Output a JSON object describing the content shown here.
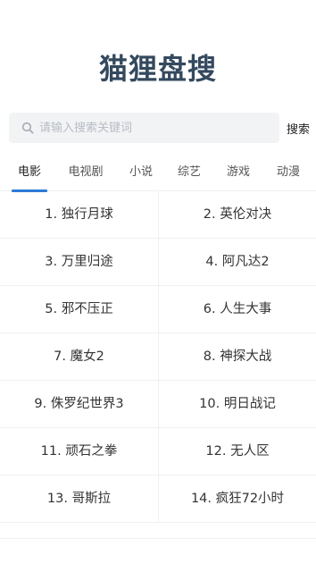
{
  "app": {
    "title": "猫狸盘搜"
  },
  "search": {
    "placeholder": "请输入搜索关键词",
    "value": "",
    "button_label": "搜索"
  },
  "tabs": [
    {
      "label": "电影",
      "active": true
    },
    {
      "label": "电视剧",
      "active": false
    },
    {
      "label": "小说",
      "active": false
    },
    {
      "label": "综艺",
      "active": false
    },
    {
      "label": "游戏",
      "active": false
    },
    {
      "label": "动漫",
      "active": false
    }
  ],
  "results": [
    "1. 独行月球",
    "2. 英伦对决",
    "3. 万里归途",
    "4. 阿凡达2",
    "5. 邪不压正",
    "6. 人生大事",
    "7. 魔女2",
    "8. 神探大战",
    "9. 侏罗纪世界3",
    "10. 明日战记",
    "11. 顽石之拳",
    "12. 无人区",
    "13. 哥斯拉",
    "14. 疯狂72小时"
  ],
  "colors": {
    "logo": "#34495e",
    "accent": "#2d7ad6",
    "search_bg": "#f2f3f5"
  }
}
